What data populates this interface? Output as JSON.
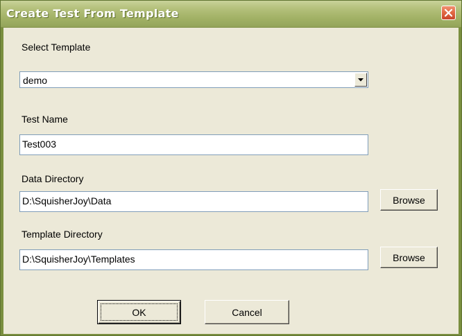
{
  "window": {
    "title": "Create Test From Template"
  },
  "form": {
    "template": {
      "label": "Select Template",
      "selected": "demo"
    },
    "test_name": {
      "label": "Test Name",
      "value": "Test003"
    },
    "data_directory": {
      "label": "Data Directory",
      "value": "D:\\SquisherJoy\\Data",
      "browse_label": "Browse"
    },
    "template_directory": {
      "label": "Template Directory",
      "value": "D:\\SquisherJoy\\Templates",
      "browse_label": "Browse"
    }
  },
  "actions": {
    "ok_label": "OK",
    "cancel_label": "Cancel"
  },
  "icons": {
    "close": "close-icon",
    "dropdown": "chevron-down-icon"
  },
  "colors": {
    "titlebar": "#a2b266",
    "window_frame": "#7a8f3f",
    "dialog_background": "#ece9d8",
    "close_button": "#e26a45",
    "field_border": "#7f9db9"
  }
}
